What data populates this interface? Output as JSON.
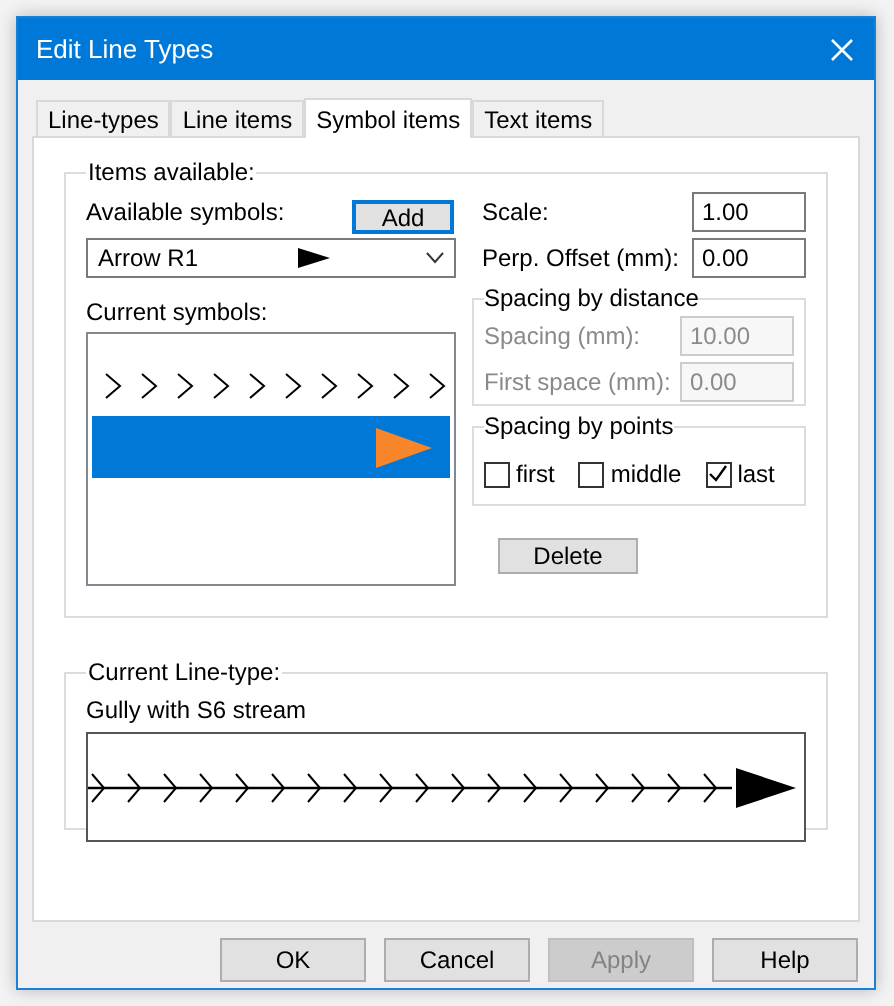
{
  "window": {
    "title": "Edit Line Types"
  },
  "tabs": [
    {
      "label": "Line-types",
      "selected": false
    },
    {
      "label": "Line items",
      "selected": false
    },
    {
      "label": "Symbol items",
      "selected": true
    },
    {
      "label": "Text items",
      "selected": false
    }
  ],
  "items_available": {
    "legend": "Items available:",
    "available_label": "Available symbols:",
    "add_button": "Add",
    "symbol_select": {
      "value": "Arrow R1"
    },
    "current_label": "Current symbols:",
    "current_symbols": [
      {
        "kind": "chevrons",
        "selected": false
      },
      {
        "kind": "orange_arrow",
        "selected": true
      }
    ],
    "scale": {
      "label": "Scale:",
      "value": "1.00"
    },
    "offset": {
      "label": "Perp. Offset (mm):",
      "value": "0.00"
    },
    "spacing_distance": {
      "legend": "Spacing by distance",
      "disabled": true,
      "fields": [
        {
          "label": "Spacing (mm):",
          "value": "10.00"
        },
        {
          "label": "First space (mm):",
          "value": "0.00"
        }
      ]
    },
    "spacing_points": {
      "legend": "Spacing by points",
      "options": [
        {
          "label": "first",
          "checked": false
        },
        {
          "label": "middle",
          "checked": false
        },
        {
          "label": "last",
          "checked": true
        }
      ]
    },
    "delete_button": "Delete"
  },
  "current_line_type": {
    "legend": "Current Line-type:",
    "name": "Gully with S6 stream"
  },
  "buttons": [
    {
      "label": "OK",
      "disabled": false
    },
    {
      "label": "Cancel",
      "disabled": false
    },
    {
      "label": "Apply",
      "disabled": true
    },
    {
      "label": "Help",
      "disabled": false
    }
  ]
}
